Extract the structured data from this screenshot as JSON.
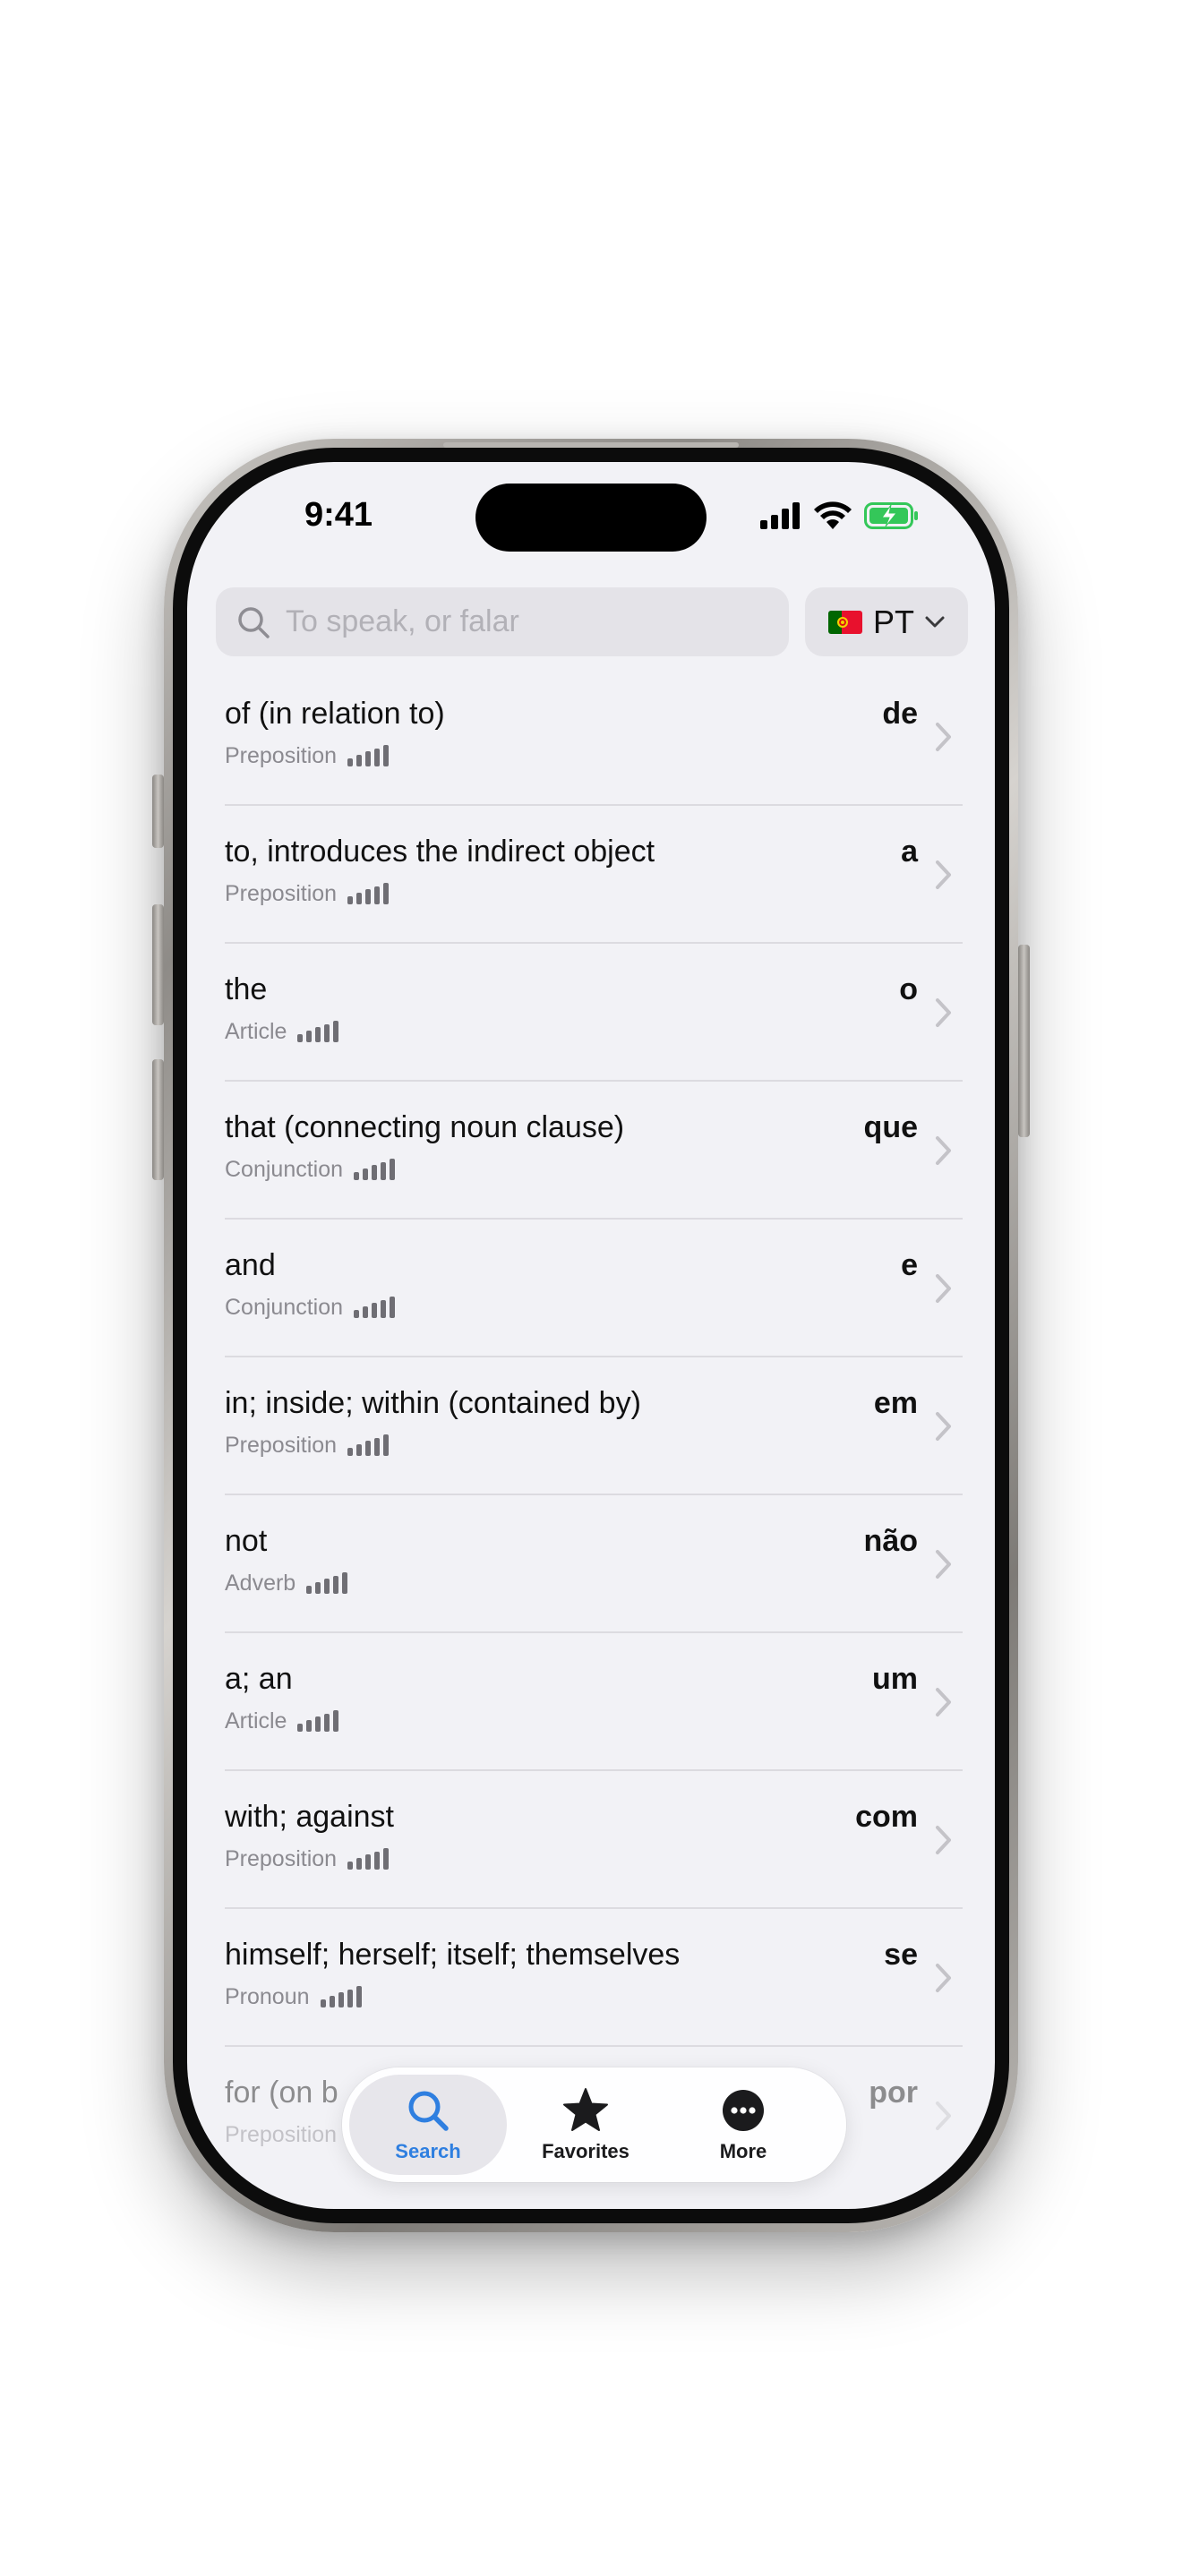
{
  "status": {
    "time": "9:41"
  },
  "search": {
    "placeholder": "To speak, or falar",
    "value": ""
  },
  "language": {
    "code": "PT",
    "flag": "portugal-flag-icon"
  },
  "colors": {
    "accent": "#2f7fe0",
    "background": "#f2f2f6",
    "secondary_text": "#8b8a90"
  },
  "entries": [
    {
      "english": "of (in relation to)",
      "pos": "Preposition",
      "portuguese": "de"
    },
    {
      "english": "to, introduces the indirect object",
      "pos": "Preposition",
      "portuguese": "a"
    },
    {
      "english": "the",
      "pos": "Article",
      "portuguese": "o"
    },
    {
      "english": "that (connecting noun clause)",
      "pos": "Conjunction",
      "portuguese": "que"
    },
    {
      "english": "and",
      "pos": "Conjunction",
      "portuguese": "e"
    },
    {
      "english": "in; inside; within (contained by)",
      "pos": "Preposition",
      "portuguese": "em"
    },
    {
      "english": "not",
      "pos": "Adverb",
      "portuguese": "não"
    },
    {
      "english": "a; an",
      "pos": "Article",
      "portuguese": "um"
    },
    {
      "english": "with; against",
      "pos": "Preposition",
      "portuguese": "com"
    },
    {
      "english": "himself; herself; itself; themselves",
      "pos": "Pronoun",
      "portuguese": "se"
    },
    {
      "english": "for (on b",
      "pos": "Preposition",
      "portuguese": "por"
    }
  ],
  "tabs": [
    {
      "label": "Search",
      "icon": "magnifier-icon",
      "selected": true
    },
    {
      "label": "Favorites",
      "icon": "star-icon",
      "selected": false
    },
    {
      "label": "More",
      "icon": "ellipsis-circle-icon",
      "selected": false
    }
  ]
}
